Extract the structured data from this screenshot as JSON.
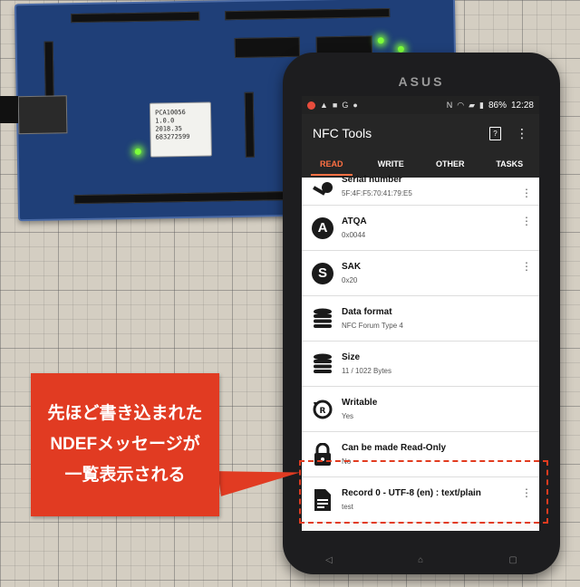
{
  "chip": {
    "line1": "PCA10056",
    "line2": "1.0.0",
    "line3": "2018.35",
    "line4": "683272599"
  },
  "phone": {
    "brand": "ASUS",
    "status": {
      "battery": "86%",
      "time": "12:28"
    }
  },
  "app": {
    "title": "NFC Tools",
    "tabs": [
      "READ",
      "WRITE",
      "OTHER",
      "TASKS"
    ],
    "active_tab": "READ",
    "records": [
      {
        "icon": "key-icon",
        "title": "Serial number",
        "value": "5F:4F:F5:70:41:79:E5"
      },
      {
        "icon": "letter-a-icon",
        "title": "ATQA",
        "value": "0x0044"
      },
      {
        "icon": "letter-s-icon",
        "title": "SAK",
        "value": "0x20"
      },
      {
        "icon": "database-icon",
        "title": "Data format",
        "value": "NFC Forum Type 4"
      },
      {
        "icon": "database-icon",
        "title": "Size",
        "value": "11 / 1022 Bytes"
      },
      {
        "icon": "rewrite-icon",
        "title": "Writable",
        "value": "Yes"
      },
      {
        "icon": "lock-icon",
        "title": "Can be made Read-Only",
        "value": "No"
      },
      {
        "icon": "document-icon",
        "title": "Record 0 - UTF-8 (en) : text/plain",
        "value": "test"
      }
    ]
  },
  "callout": {
    "line1": "先ほど書き込まれた",
    "line2": "NDEFメッセージが",
    "line3": "一覧表示される"
  },
  "colors": {
    "callout": "#e13b22",
    "active_tab": "#ff7043",
    "board": "#1f3f78"
  }
}
